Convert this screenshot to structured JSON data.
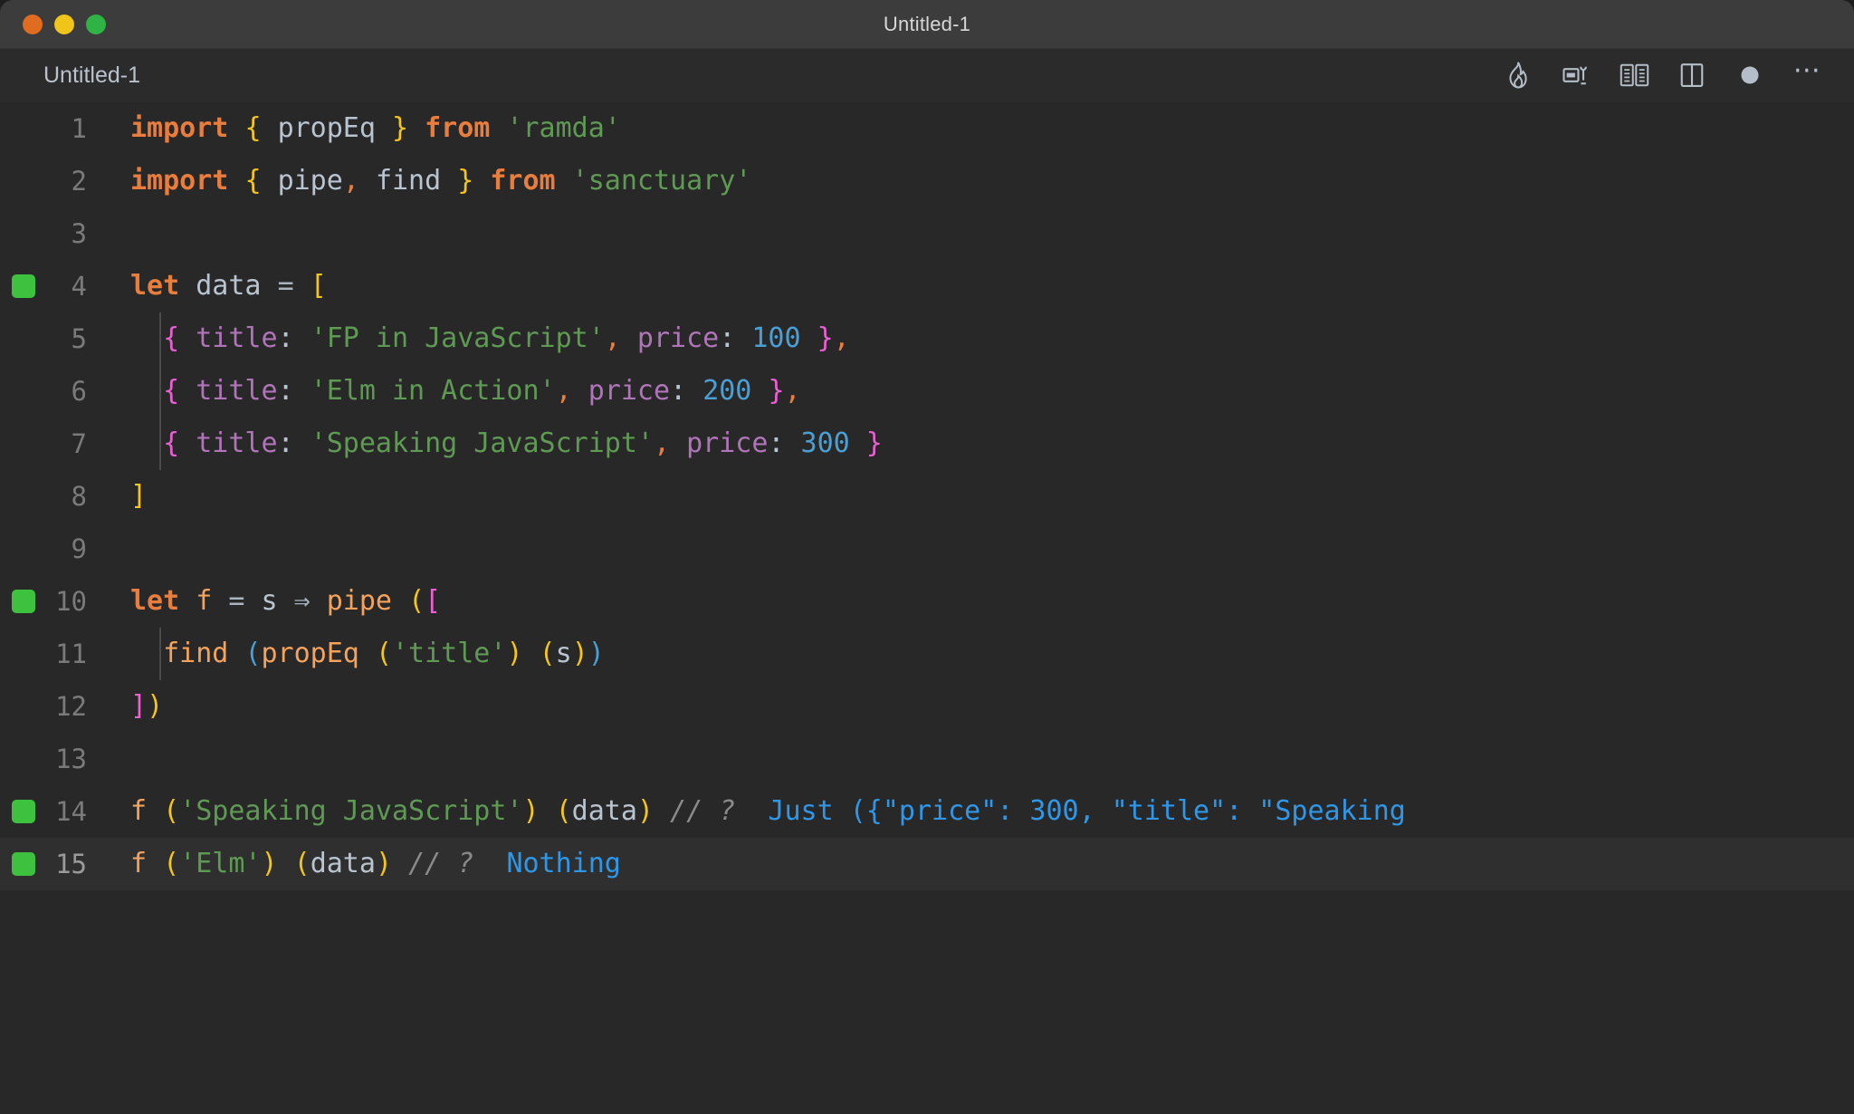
{
  "window": {
    "title": "Untitled-1",
    "traffic_lights": [
      "close",
      "minimize",
      "maximize"
    ]
  },
  "tabbar": {
    "tab_label": "Untitled-1",
    "icons": [
      {
        "name": "flame-icon",
        "label": "Quokka"
      },
      {
        "name": "run-split-icon",
        "label": "Run and Debug"
      },
      {
        "name": "open-book-icon",
        "label": "Open Preview"
      },
      {
        "name": "split-editor-icon",
        "label": "Split Editor"
      },
      {
        "name": "unsaved-dot-icon",
        "label": "Unsaved"
      },
      {
        "name": "more-actions-icon",
        "label": "More Actions..."
      }
    ]
  },
  "editor": {
    "language": "javascript",
    "current_line": 15,
    "lines": [
      {
        "n": "1",
        "marked": false,
        "indent_guide": false
      },
      {
        "n": "2",
        "marked": false,
        "indent_guide": false
      },
      {
        "n": "3",
        "marked": false,
        "indent_guide": false
      },
      {
        "n": "4",
        "marked": true,
        "indent_guide": false
      },
      {
        "n": "5",
        "marked": false,
        "indent_guide": true
      },
      {
        "n": "6",
        "marked": false,
        "indent_guide": true
      },
      {
        "n": "7",
        "marked": false,
        "indent_guide": true
      },
      {
        "n": "8",
        "marked": false,
        "indent_guide": false
      },
      {
        "n": "9",
        "marked": false,
        "indent_guide": false
      },
      {
        "n": "10",
        "marked": true,
        "indent_guide": false
      },
      {
        "n": "11",
        "marked": false,
        "indent_guide": true
      },
      {
        "n": "12",
        "marked": false,
        "indent_guide": false
      },
      {
        "n": "13",
        "marked": false,
        "indent_guide": false
      },
      {
        "n": "14",
        "marked": true,
        "indent_guide": false
      },
      {
        "n": "15",
        "marked": true,
        "indent_guide": false
      }
    ],
    "source_text": [
      "import { propEq } from 'ramda'",
      "import { pipe, find } from 'sanctuary'",
      "",
      "let data = [",
      "  { title: 'FP in JavaScript', price: 100 },",
      "  { title: 'Elm in Action', price: 200 },",
      "  { title: 'Speaking JavaScript', price: 300 }",
      "]",
      "",
      "let f = s ⇒ pipe ([",
      "  find (propEq ('title') (s))",
      "])",
      "",
      "f ('Speaking JavaScript') (data) // ?  Just ({\"price\": 300, \"title\": \"Speaking",
      "f ('Elm') (data) // ?  Nothing"
    ],
    "tokens": {
      "l1": {
        "kw_import": "import",
        "b_open": "{",
        "name": "propEq",
        "b_close": "}",
        "kw_from": "from",
        "module": "'ramda'"
      },
      "l2": {
        "kw_import": "import",
        "b_open": "{",
        "name1": "pipe",
        "comma": ",",
        "name2": "find",
        "b_close": "}",
        "kw_from": "from",
        "module": "'sanctuary'"
      },
      "l4": {
        "kw_let": "let",
        "name": "data",
        "eq": "=",
        "bracket": "["
      },
      "l5": {
        "brace_open": "{",
        "key": "title",
        "colon": ":",
        "value": "'FP in JavaScript'",
        "comma": ",",
        "key2": "price",
        "colon2": ":",
        "num": "100",
        "brace_close": "}",
        "trail": ","
      },
      "l6": {
        "brace_open": "{",
        "key": "title",
        "colon": ":",
        "value": "'Elm in Action'",
        "comma": ",",
        "key2": "price",
        "colon2": ":",
        "num": "200",
        "brace_close": "}",
        "trail": ","
      },
      "l7": {
        "brace_open": "{",
        "key": "title",
        "colon": ":",
        "value": "'Speaking JavaScript'",
        "comma": ",",
        "key2": "price",
        "colon2": ":",
        "num": "300",
        "brace_close": "}"
      },
      "l8": {
        "bracket": "]"
      },
      "l10": {
        "kw_let": "let",
        "name": "f",
        "eq": "=",
        "param": "s",
        "arrow": "⇒",
        "fn": "pipe",
        "paren": "(",
        "bracket": "["
      },
      "l11": {
        "fn1": "find",
        "paren1": "(",
        "fn2": "propEq",
        "paren2": "(",
        "str": "'title'",
        "paren2c": ")",
        "paren3": "(",
        "param": "s",
        "paren3c": ")",
        "paren1c": ")"
      },
      "l12": {
        "bracket": "]",
        "paren": ")"
      },
      "l14": {
        "fn": "f",
        "paren": "(",
        "str": "'Speaking JavaScript'",
        "parenc": ")",
        "paren2": "(",
        "arg": "data",
        "paren2c": ")",
        "comment": "// ?",
        "result": "Just ({\"price\": 300, \"title\": \"Speaking"
      },
      "l15": {
        "fn": "f",
        "paren": "(",
        "str": "'Elm'",
        "parenc": ")",
        "paren2": "(",
        "arg": "data",
        "paren2c": ")",
        "comment": "// ?",
        "result": "Nothing"
      }
    }
  },
  "colors": {
    "background": "#282828",
    "titlebar": "#3c3c3c",
    "keyword": "#e87d3e",
    "string": "#5f9a55",
    "number": "#4a9fd4",
    "property": "#b074b8",
    "function": "#f5a35c",
    "comment": "#8a8a8a",
    "result": "#2f97e8",
    "bracket_yellow": "#f5c518",
    "bracket_magenta": "#ec5fd3",
    "gutter_marker": "#3ec13e"
  }
}
